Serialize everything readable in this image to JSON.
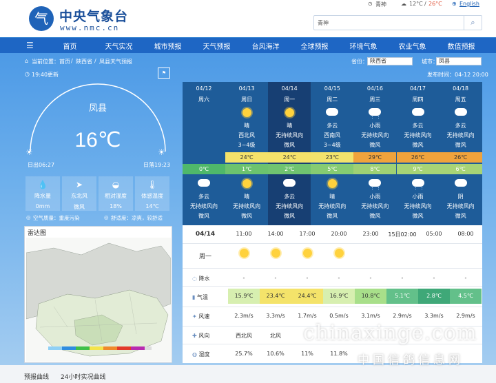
{
  "header": {
    "logo_glyph": "气",
    "logo_cn": "中央气象台",
    "logo_en": "www.nmc.cn",
    "top_city": "青神",
    "top_temp_low": "12°C",
    "top_temp_high": "26°C",
    "lang": "English",
    "search_value": "青神"
  },
  "nav": {
    "items": [
      "首页",
      "天气实况",
      "城市预报",
      "天气预报",
      "台风海洋",
      "全球预报",
      "环境气象",
      "农业气象",
      "数值预报"
    ]
  },
  "crumb": {
    "label": "当前位置：",
    "items": [
      "首页",
      "陕西省",
      "凤县天气预报"
    ],
    "province_label": "省份：",
    "province": "陕西省",
    "city_label": "城市：",
    "city": "凤县",
    "publish": "发布时间：04-12 20:00"
  },
  "current": {
    "update": "19:40更新",
    "city": "凤县",
    "temp": "16℃",
    "sunrise": "日出06:27",
    "sunset": "日落19:23",
    "stats": [
      {
        "icon": "rain-drops-icon",
        "glyph": "💧",
        "label": "降水量",
        "value": "0mm"
      },
      {
        "icon": "wind-icon",
        "glyph": "➤",
        "label": "东北风",
        "value": "微风"
      },
      {
        "icon": "humidity-icon",
        "glyph": "◒",
        "label": "相对湿度",
        "value": "18%"
      },
      {
        "icon": "thermometer-icon",
        "glyph": "🌡",
        "label": "体感温度",
        "value": "14℃"
      }
    ],
    "air_quality": "空气质量：重度污染",
    "comfort": "舒适度：凉爽，较舒适"
  },
  "radar": {
    "title": "雷达图"
  },
  "forecast": [
    {
      "date": "04/12",
      "day": "周六",
      "day_icon": "",
      "day_weather": "",
      "day_wind": "",
      "day_level": "",
      "high": "",
      "low": "0℃",
      "night_icon": "cloud-icon",
      "night_weather": "多云",
      "night_wind": "无持续风向",
      "night_level": "微风"
    },
    {
      "date": "04/13",
      "day": "周日",
      "day_icon": "sun-icon",
      "day_weather": "晴",
      "day_wind": "西北风",
      "day_level": "3~4级",
      "high": "24℃",
      "low": "1℃",
      "night_icon": "sun-icon",
      "night_weather": "晴",
      "night_wind": "无持续风向",
      "night_level": "微风"
    },
    {
      "date": "04/14",
      "day": "周一",
      "day_icon": "sun-icon",
      "day_weather": "晴",
      "day_wind": "无持续风向",
      "day_level": "微风",
      "high": "24℃",
      "low": "2℃",
      "night_icon": "cloud-icon",
      "night_weather": "多云",
      "night_wind": "无持续风向",
      "night_level": "微风"
    },
    {
      "date": "04/15",
      "day": "周二",
      "day_icon": "partly-cloudy-icon",
      "day_weather": "多云",
      "day_wind": "西南风",
      "day_level": "3~4级",
      "high": "23℃",
      "low": "5℃",
      "night_icon": "sun-icon",
      "night_weather": "晴",
      "night_wind": "无持续风向",
      "night_level": "微风"
    },
    {
      "date": "04/16",
      "day": "周三",
      "day_icon": "rain-icon",
      "day_weather": "小雨",
      "day_wind": "无持续风向",
      "day_level": "微风",
      "high": "29℃",
      "low": "8℃",
      "night_icon": "rain-icon",
      "night_weather": "小雨",
      "night_wind": "无持续风向",
      "night_level": "微风"
    },
    {
      "date": "04/17",
      "day": "周四",
      "day_icon": "partly-cloudy-icon",
      "day_weather": "多云",
      "day_wind": "无持续风向",
      "day_level": "微风",
      "high": "26℃",
      "low": "9℃",
      "night_icon": "rain-icon",
      "night_weather": "小雨",
      "night_wind": "无持续风向",
      "night_level": "微风"
    },
    {
      "date": "04/18",
      "day": "周五",
      "day_icon": "partly-cloudy-icon",
      "day_weather": "多云",
      "day_wind": "无持续风向",
      "day_level": "微风",
      "high": "26℃",
      "low": "6℃",
      "night_icon": "cloud-icon",
      "night_weather": "阴",
      "night_wind": "无持续风向",
      "night_level": "微风"
    }
  ],
  "colors": {
    "high": [
      "",
      "#f5e26a",
      "#f5e26a",
      "#f3e36c",
      "#f0a33c",
      "#f0a33c",
      "#f0a33c"
    ],
    "low": [
      "#4fb86a",
      "#6cc36e",
      "#70c470",
      "#86cc72",
      "#9fd174",
      "#a7d476",
      "#a7d476"
    ]
  },
  "hourly": {
    "date": "04/14",
    "weekday": "周一",
    "times": [
      "11:00",
      "14:00",
      "17:00",
      "20:00",
      "23:00",
      "15日02:00",
      "05:00",
      "08:00"
    ],
    "icons": [
      "sun-icon",
      "sun-icon",
      "sun-icon",
      "sun-icon",
      "cloud-icon",
      "cloud-icon",
      "cloud-icon",
      "cloud-icon"
    ],
    "row_labels": {
      "rain": "降水",
      "temp": "气温",
      "wind_speed": "风速",
      "wind_dir": "风向",
      "humidity": "湿度"
    },
    "rain": [
      "-",
      "-",
      "-",
      "-",
      "-",
      "-",
      "-",
      "-"
    ],
    "temp": [
      "15.9℃",
      "23.4℃",
      "24.4℃",
      "16.9℃",
      "10.8℃",
      "5.1℃",
      "2.8℃",
      "4.5℃"
    ],
    "temp_colors": [
      "#d7efb0",
      "#f4e36a",
      "#f4e36a",
      "#d7efb0",
      "#a8df8a",
      "#63c08a",
      "#3fa878",
      "#63c08a"
    ],
    "wind_speed": [
      "2.3m/s",
      "3.3m/s",
      "1.7m/s",
      "0.5m/s",
      "3.1m/s",
      "2.9m/s",
      "3.3m/s",
      "2.9m/s"
    ],
    "wind_dir": [
      "西北风",
      "北风",
      "",
      "",
      "",
      "",
      "",
      ""
    ],
    "humidity": [
      "25.7%",
      "10.6%",
      "11%",
      "11.8%",
      "",
      "",
      "",
      ""
    ]
  },
  "footer": {
    "tab1": "预报曲线",
    "tab2": "24小时实况曲线"
  },
  "watermark": {
    "text": "chinaxinge.com",
    "text2": "中国信鸽信息网"
  }
}
